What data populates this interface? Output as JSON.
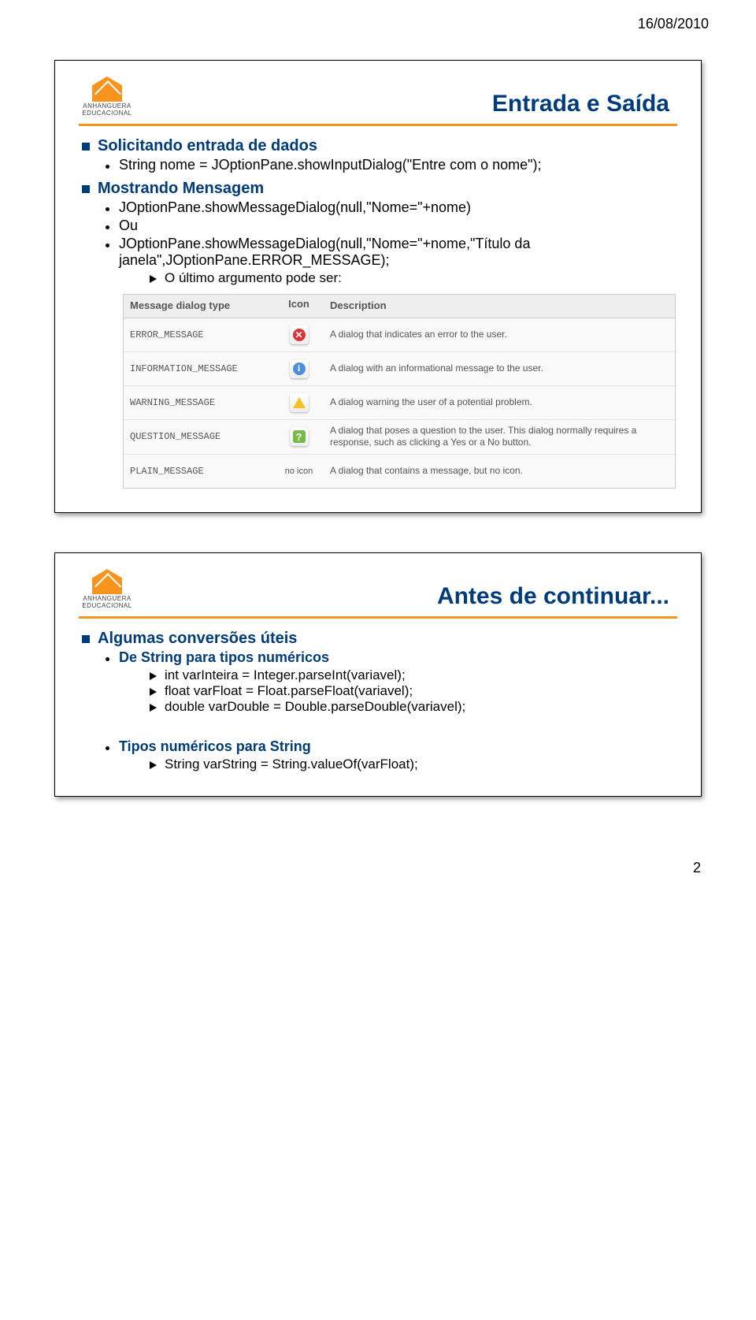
{
  "page_date": "16/08/2010",
  "logo_text": "ANHANGUERA EDUCACIONAL",
  "slide1": {
    "title": "Entrada e Saída",
    "sec1_title": "Solicitando entrada de dados",
    "sec1_line1": "String nome = JOptionPane.showInputDialog(\"Entre com o nome\");",
    "sec2_title": "Mostrando Mensagem",
    "sec2_line1": "JOptionPane.showMessageDialog(null,\"Nome=\"+nome)",
    "sec2_line2": "Ou",
    "sec2_line3": "JOptionPane.showMessageDialog(null,\"Nome=\"+nome,\"Título da janela\",JOptionPane.ERROR_MESSAGE);",
    "sec2_sub1": "O último argumento pode ser:",
    "table": {
      "h_type": "Message dialog type",
      "h_icon": "Icon",
      "h_desc": "Description",
      "rows": [
        {
          "type": "ERROR_MESSAGE",
          "icon": "error",
          "desc": "A dialog that indicates an error to the user."
        },
        {
          "type": "INFORMATION_MESSAGE",
          "icon": "info",
          "desc": "A dialog with an informational message to the user."
        },
        {
          "type": "WARNING_MESSAGE",
          "icon": "warn",
          "desc": "A dialog warning the user of a potential problem."
        },
        {
          "type": "QUESTION_MESSAGE",
          "icon": "question",
          "desc": "A dialog that poses a question to the user. This dialog normally requires a response, such as clicking a Yes or a No button."
        },
        {
          "type": "PLAIN_MESSAGE",
          "icon": "no icon",
          "desc": "A dialog that contains a message, but no icon."
        }
      ]
    }
  },
  "slide2": {
    "title": "Antes de continuar...",
    "sec1_title": "Algumas conversões úteis",
    "sub1_title": "De String para tipos numéricos",
    "sub1_l1": "int varInteira = Integer.parseInt(variavel);",
    "sub1_l2": "float varFloat = Float.parseFloat(variavel);",
    "sub1_l3": "double varDouble = Double.parseDouble(variavel);",
    "sub2_title": "Tipos numéricos para String",
    "sub2_l1": "String varString = String.valueOf(varFloat);"
  },
  "page_number": "2"
}
